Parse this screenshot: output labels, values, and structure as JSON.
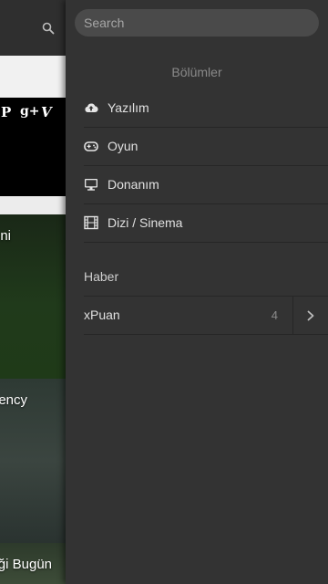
{
  "search": {
    "placeholder": "Search"
  },
  "drawer": {
    "section_title": "Bölümler",
    "items": [
      {
        "label": "Yazılım",
        "icon": "cloud-upload-icon"
      },
      {
        "label": "Oyun",
        "icon": "gamepad-icon"
      },
      {
        "label": "Donanım",
        "icon": "monitor-icon"
      },
      {
        "label": "Dizi / Sinema",
        "icon": "film-icon"
      }
    ],
    "news": "Haber",
    "xpuan": {
      "label": "xPuan",
      "count": "4"
    }
  },
  "background": {
    "social_icons": [
      "P",
      "g+",
      "V"
    ],
    "cards": [
      "ni",
      "ency",
      "ği Bugün"
    ]
  },
  "colors": {
    "drawer_bg": "#333333",
    "search_bg": "#4a4a4a",
    "divider": "#262626"
  }
}
